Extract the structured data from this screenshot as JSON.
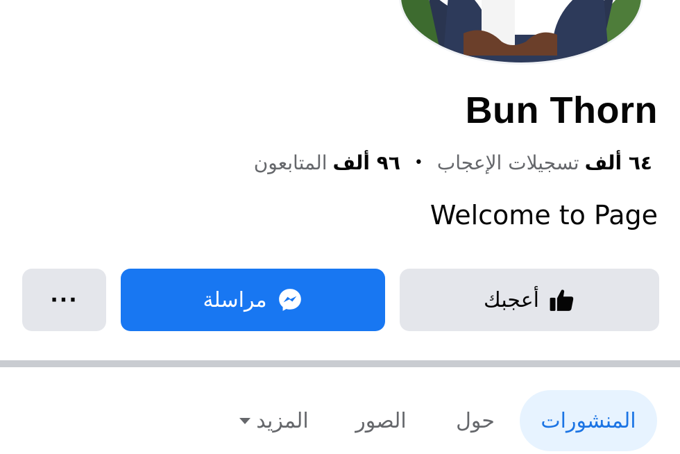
{
  "profile": {
    "name": "Bun Thorn",
    "likes_count": "٦٤ ألف",
    "likes_label": "تسجيلات الإعجاب",
    "separator": "•",
    "followers_count": "٩٦ ألف",
    "followers_label": "المتابعون",
    "bio": "Welcome to Page",
    "avatar_icon": "profile-photo"
  },
  "actions": {
    "like_label": "أعجبك",
    "like_icon": "thumbs-up-icon",
    "message_label": "مراسلة",
    "message_icon": "messenger-icon",
    "more_label": "···"
  },
  "tabs": [
    {
      "label": "المنشورات",
      "active": true
    },
    {
      "label": "حول",
      "active": false
    },
    {
      "label": "الصور",
      "active": false
    },
    {
      "label": "المزيد",
      "active": false
    }
  ],
  "colors": {
    "primary": "#1877f2",
    "active_tab_bg": "#e7f3ff",
    "active_tab_text": "#1b74e4",
    "secondary_button": "#e4e6eb",
    "muted_text": "#65676b"
  }
}
